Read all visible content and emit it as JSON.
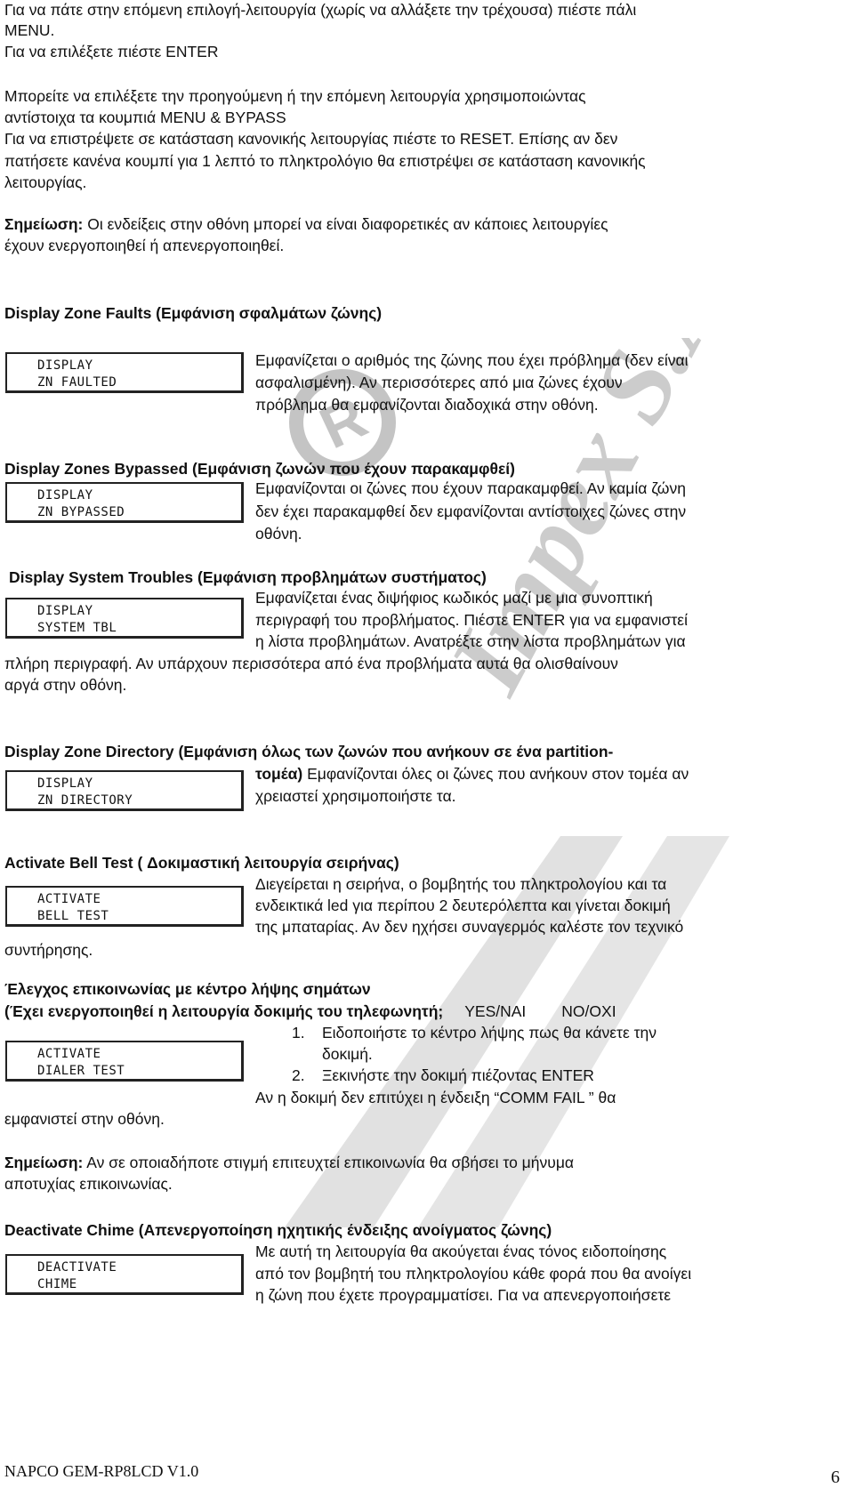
{
  "intro": [
    "Για να πάτε στην επόμενη επιλογή-λειτουργία (χωρίς να αλλάξετε την τρέχουσα) πιέστε πάλι",
    "MENU.",
    "Για να επιλέξετε πιέστε ENTER",
    "Μπορείτε να επιλέξετε την προηγούμενη ή την επόμενη λειτουργία χρησιμοποιώντας",
    "αντίστοιχα τα κουμπιά MENU & BYPASS",
    "Για να επιστρέψετε σε κατάσταση κανονικής λειτουργίας πιέστε το RESET. Επίσης αν δεν",
    "πατήσετε κανένα κουμπί για 1 λεπτό το πληκτρολόγιο θα επιστρέψει σε κατάσταση κανονικής",
    "λειτουργίας."
  ],
  "note1": {
    "label": "Σημείωση:",
    "text": " Οι ενδείξεις στην οθόνη μπορεί να είναι διαφορετικές αν κάποιες λειτουργίες",
    "line2": "έχουν ενεργοποιηθεί ή απενεργοποιηθεί."
  },
  "s1": {
    "title": "Display Zone Faults (Εμφάνιση σφαλμάτων ζώνης)",
    "lcd": [
      "DISPLAY",
      "ZN FAULTED"
    ],
    "lines": [
      "Εμφανίζεται ο αριθμός της ζώνης που έχει πρόβλημα (δεν είναι",
      "ασφαλισμένη). Αν περισσότερες από μια ζώνες έχουν",
      "πρόβλημα θα εμφανίζονται διαδοχικά στην οθόνη."
    ]
  },
  "s2": {
    "title": "Display Zones Bypassed (Εμφάνιση ζωνών που έχουν παρακαμφθεί)",
    "lcd": [
      "DISPLAY",
      "ZN BYPASSED"
    ],
    "lines": [
      "Εμφανίζονται οι ζώνες που έχουν παρακαμφθεί. Αν καμία ζώνη",
      "δεν έχει παρακαμφθεί δεν εμφανίζονται αντίστοιχες ζώνες στην",
      "οθόνη."
    ]
  },
  "s3": {
    "title": "Display System Troubles  (Εμφάνιση προβλημάτων συστήματος)",
    "lcd": [
      "DISPLAY",
      "SYSTEM TBL"
    ],
    "lines": [
      "Εμφανίζεται ένας διψήφιος κωδικός μαζί με μια συνοπτική",
      "περιγραφή του προβλήματος. Πιέστε ENTER για να εμφανιστεί",
      "η λίστα προβλημάτων. Ανατρέξτε στην λίστα προβλημάτων για"
    ],
    "full": [
      "πλήρη περιγραφή. Αν υπάρχουν περισσότερα από ένα προβλήματα αυτά θα ολισθαίνουν",
      "αργά στην οθόνη."
    ]
  },
  "s4": {
    "title": "Display Zone Directory  (Εμφάνιση όλως των ζωνών που ανήκουν σε ένα partition-",
    "lcd": [
      "DISPLAY",
      "ZN DIRECTORY"
    ],
    "bold2": "τομέα)",
    "line2": " Εμφανίζονται όλες οι ζώνες που ανήκουν στον τομέα αν",
    "line3": "χρειαστεί χρησιμοποιήστε τα."
  },
  "s5": {
    "title": "Activate Bell Test ( Δοκιμαστική λειτουργία σειρήνας)",
    "lcd": [
      "ACTIVATE",
      "BELL TEST"
    ],
    "lines": [
      "Διεγείρεται  η σειρήνα, ο βομβητής του πληκτρολογίου και τα",
      "ενδεικτικά led για περίπου 2 δευτερόλεπτα και γίνεται δοκιμή",
      "της μπαταρίας. Αν δεν ηχήσει συναγερμός καλέστε τον τεχνικό"
    ],
    "full": "συντήρησης."
  },
  "s6": {
    "title": "Έλεγχος επικοινωνίας με κέντρο λήψης σημάτων",
    "title2": "(Έχει ενεργοποιηθεί η λειτουργία δοκιμής του τηλεφωνητή;",
    "yes": "YES/NAI",
    "no": "NO/OXI",
    "lcd": [
      "ACTIVATE",
      "DIALER TEST"
    ],
    "steps": [
      {
        "n": "1.",
        "t": "Ειδοποιήστε το κέντρο λήψης πως θα κάνετε την",
        "t2": "δοκιμή."
      },
      {
        "n": "2.",
        "t": "Ξεκινήστε την δοκιμή πιέζοντας ENTER"
      }
    ],
    "line": "Αν η δοκιμή δεν επιτύχει η ένδειξη  “COMM FAIL ”  θα",
    "full": "εμφανιστεί στην οθόνη."
  },
  "note2": {
    "label": "Σημείωση:",
    "text": " Αν σε οποιαδήποτε στιγμή επιτευχτεί επικοινωνία θα σβήσει το μήνυμα",
    "line2": "αποτυχίας επικοινωνίας."
  },
  "s7": {
    "title": "Deactivate Chime (Απενεργοποίηση ηχητικής ένδειξης ανοίγματος ζώνης)",
    "lcd": [
      "DEACTIVATE",
      "CHIME"
    ],
    "lines": [
      "Με αυτή τη λειτουργία  θα ακούγεται ένας τόνος ειδοποίησης",
      "από τον βομβητή του πληκτρολογίου κάθε φορά που θα ανοίγει",
      "η ζώνη που έχετε προγραμματίσει. Για να απενεργοποιήσετε"
    ]
  },
  "watermark": {
    "text": "Impex S.A.",
    "symbol": "®",
    "color": "#c8c8c8"
  },
  "footer": {
    "doc": "NAPCO GEM-RP8LCD  V1.0",
    "page": "6"
  }
}
